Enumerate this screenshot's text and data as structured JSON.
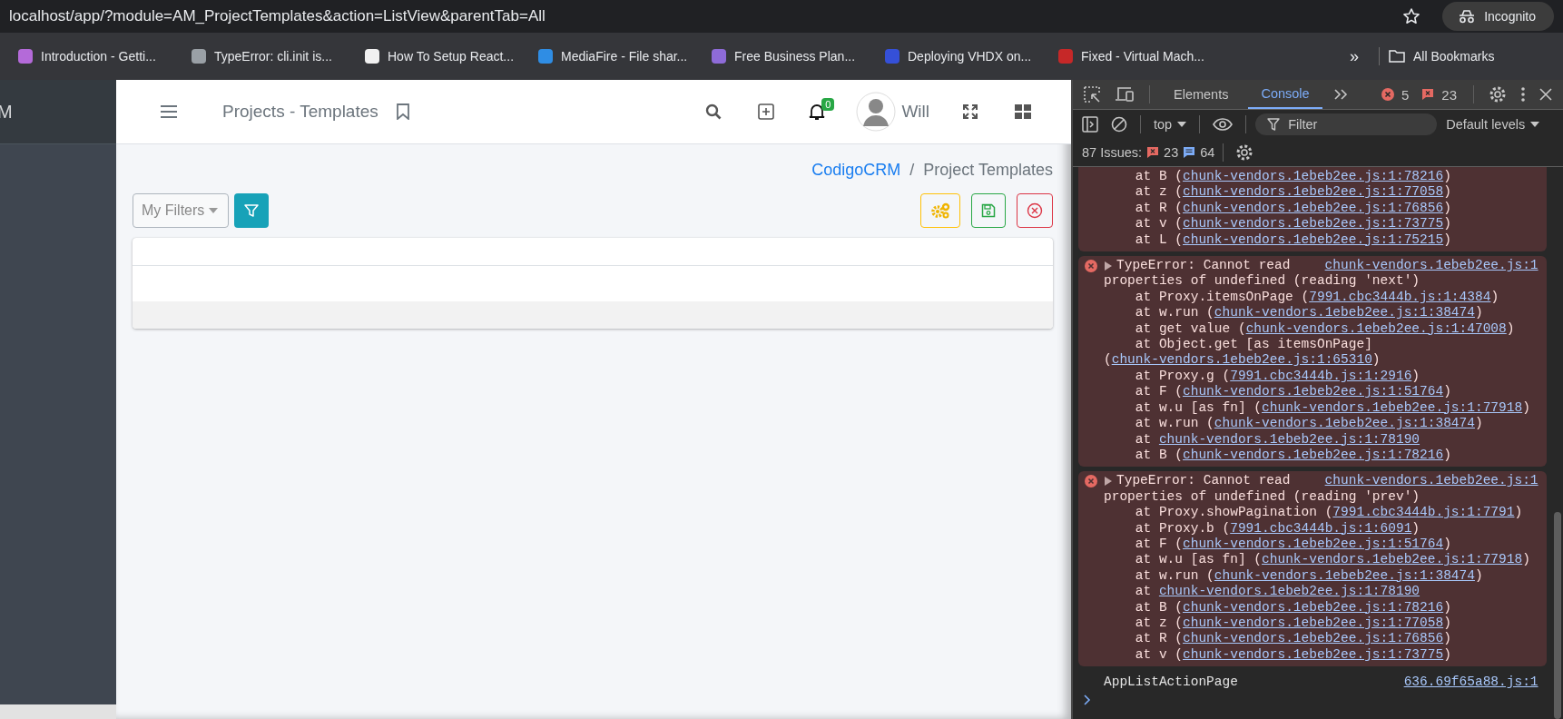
{
  "browser": {
    "url": "localhost/app/?module=AM_ProjectTemplates&action=ListView&parentTab=All",
    "profile": "Incognito",
    "bookmarks": [
      {
        "label": "Introduction - Getti...",
        "color": "#b46ad9"
      },
      {
        "label": "TypeError: cli.init is...",
        "color": "#9aa0a6"
      },
      {
        "label": "How To Setup React...",
        "color": "#f1f1f1"
      },
      {
        "label": "MediaFire - File shar...",
        "color": "#2f8de4"
      },
      {
        "label": "Free Business Plan...",
        "color": "#8e6bd8"
      },
      {
        "label": "Deploying VHDX on...",
        "color": "#3550d8"
      },
      {
        "label": "Fixed - Virtual Mach...",
        "color": "#c62828"
      }
    ],
    "overflow": "»",
    "all_bookmarks": "All Bookmarks"
  },
  "sidebar": {
    "brand": "M"
  },
  "header": {
    "title": "Projects - Templates",
    "notification_count": "0",
    "user": "Will"
  },
  "breadcrumb": [
    {
      "label": "CodigoCRM",
      "link": true
    },
    {
      "label": "Project Templates",
      "link": false
    }
  ],
  "breadcrumb_separator": "/",
  "filters": {
    "label": "My Filters"
  },
  "devtools": {
    "tabs": [
      {
        "label": "Elements",
        "selected": false
      },
      {
        "label": "Console",
        "selected": true
      }
    ],
    "error_count": "5",
    "issue_count": "23",
    "context": "top",
    "filter_placeholder": "Filter",
    "levels": "Default levels",
    "issues": {
      "label": "87 Issues:",
      "errors": "23",
      "info": "64"
    },
    "console": [
      {
        "kind": "error",
        "frames": [
          {
            "text": "at B (",
            "link": "chunk-vendors.1ebeb2ee.js:1:78216",
            "end": ")"
          },
          {
            "text": "at z (",
            "link": "chunk-vendors.1ebeb2ee.js:1:77058",
            "end": ")"
          },
          {
            "text": "at R (",
            "link": "chunk-vendors.1ebeb2ee.js:1:76856",
            "end": ")"
          },
          {
            "text": "at v (",
            "link": "chunk-vendors.1ebeb2ee.js:1:73775",
            "end": ")"
          },
          {
            "text": "at L (",
            "link": "chunk-vendors.1ebeb2ee.js:1:75215",
            "end": ")"
          }
        ]
      },
      {
        "kind": "error",
        "message": [
          "TypeError: Cannot read",
          "properties of undefined (reading 'next')"
        ],
        "source": "chunk-vendors.1ebeb2ee.js:1",
        "frames": [
          {
            "text": "at Proxy.itemsOnPage (",
            "link": "7991.cbc3444b.js:1:4384",
            "end": ")"
          },
          {
            "text": "at w.run (",
            "link": "chunk-vendors.1ebeb2ee.js:1:38474",
            "end": ")"
          },
          {
            "text": "at get value (",
            "link": "chunk-vendors.1ebeb2ee.js:1:47008",
            "end": ")"
          },
          {
            "text": "at Object.get [as itemsOnPage] (",
            "link": "chunk-vendors.1ebeb2ee.js:1:65310",
            "end": ")"
          },
          {
            "text": "at Proxy.g (",
            "link": "7991.cbc3444b.js:1:2916",
            "end": ")"
          },
          {
            "text": "at F (",
            "link": "chunk-vendors.1ebeb2ee.js:1:51764",
            "end": ")"
          },
          {
            "text": "at w.u [as fn] (",
            "link": "chunk-vendors.1ebeb2ee.js:1:77918",
            "end": ")"
          },
          {
            "text": "at w.run (",
            "link": "chunk-vendors.1ebeb2ee.js:1:38474",
            "end": ")"
          },
          {
            "text": "at ",
            "link": "chunk-vendors.1ebeb2ee.js:1:78190"
          },
          {
            "text": "at B (",
            "link": "chunk-vendors.1ebeb2ee.js:1:78216",
            "end": ")"
          }
        ]
      },
      {
        "kind": "error",
        "message": [
          "TypeError: Cannot read",
          "properties of undefined (reading 'prev')"
        ],
        "source": "chunk-vendors.1ebeb2ee.js:1",
        "frames": [
          {
            "text": "at Proxy.showPagination (",
            "link": "7991.cbc3444b.js:1:7791",
            "end": ")"
          },
          {
            "text": "at Proxy.b (",
            "link": "7991.cbc3444b.js:1:6091",
            "end": ")"
          },
          {
            "text": "at F (",
            "link": "chunk-vendors.1ebeb2ee.js:1:51764",
            "end": ")"
          },
          {
            "text": "at w.u [as fn] (",
            "link": "chunk-vendors.1ebeb2ee.js:1:77918",
            "end": ")"
          },
          {
            "text": "at w.run (",
            "link": "chunk-vendors.1ebeb2ee.js:1:38474",
            "end": ")"
          },
          {
            "text": "at ",
            "link": "chunk-vendors.1ebeb2ee.js:1:78190"
          },
          {
            "text": "at B (",
            "link": "chunk-vendors.1ebeb2ee.js:1:78216",
            "end": ")"
          },
          {
            "text": "at z (",
            "link": "chunk-vendors.1ebeb2ee.js:1:77058",
            "end": ")"
          },
          {
            "text": "at R (",
            "link": "chunk-vendors.1ebeb2ee.js:1:76856",
            "end": ")"
          },
          {
            "text": "at v (",
            "link": "chunk-vendors.1ebeb2ee.js:1:73775",
            "end": ")"
          }
        ]
      },
      {
        "kind": "log",
        "message": "AppListActionPage",
        "source": "636.69f65a88.js:1"
      }
    ]
  }
}
